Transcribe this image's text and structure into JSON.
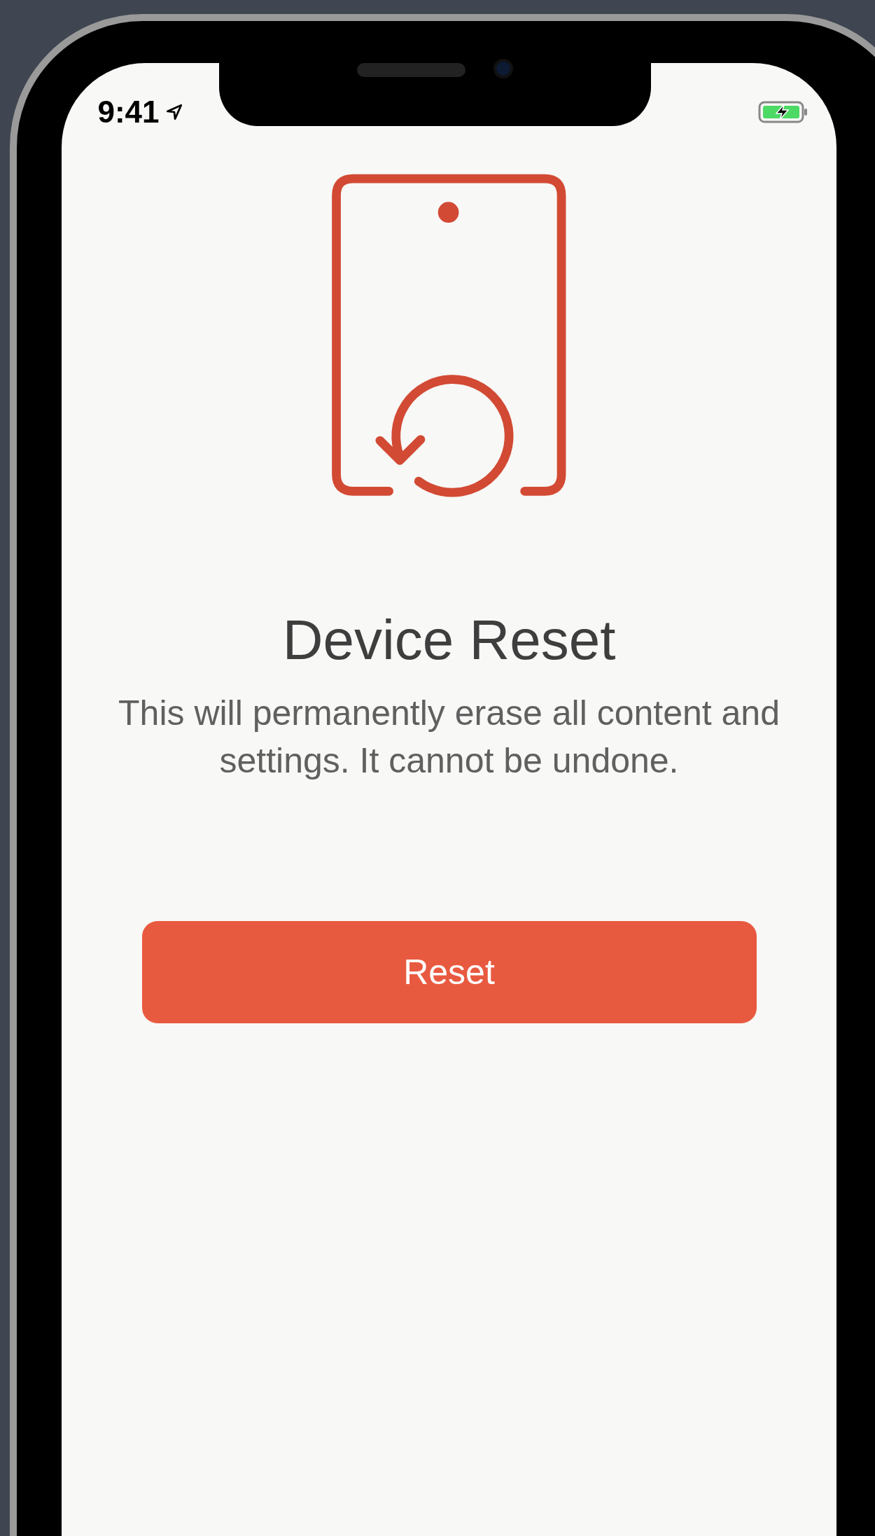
{
  "status_bar": {
    "time": "9:41"
  },
  "title": "Device Reset",
  "message": "This will permanently erase all content and settings. It cannot be undone.",
  "button": {
    "label": "Reset"
  }
}
